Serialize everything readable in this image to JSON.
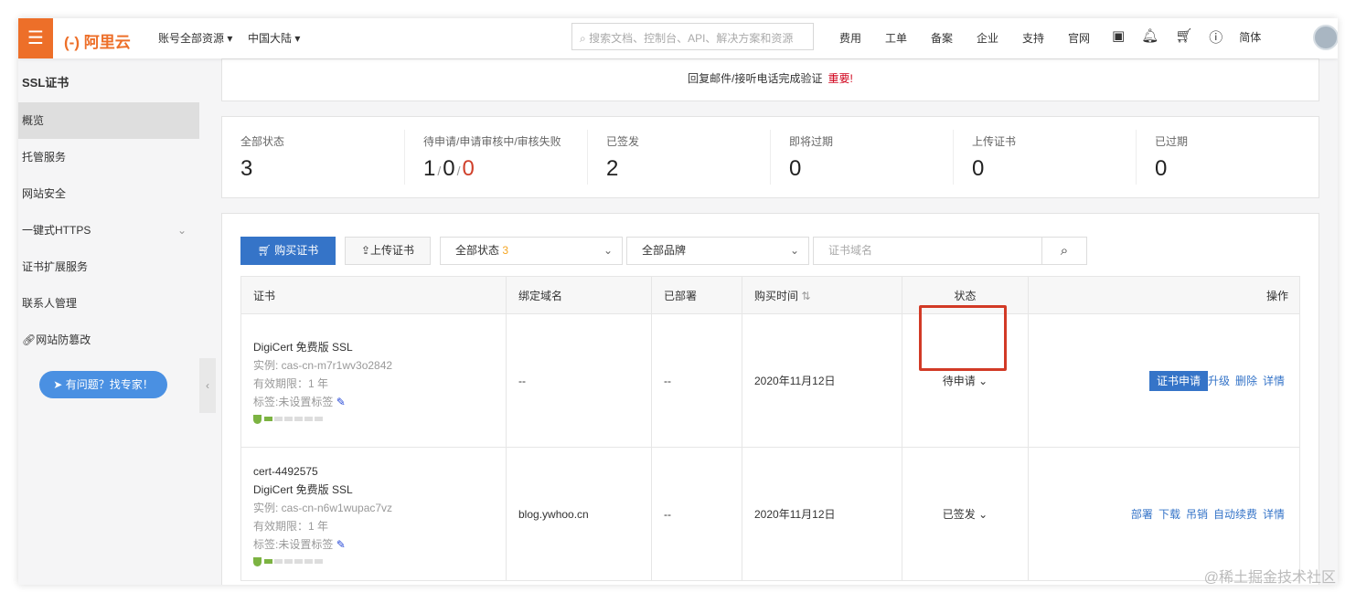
{
  "topbar": {
    "logo": "(-) 阿里云",
    "account": "账号全部资源 ▾",
    "region": "中国大陆 ▾",
    "search_placeholder": "搜索文档、控制台、API、解决方案和资源",
    "links": [
      "费用",
      "工单",
      "备案",
      "企业",
      "支持",
      "官网"
    ],
    "lang": "简体"
  },
  "sidebar": {
    "title": "SSL证书",
    "items": [
      "概览",
      "托管服务",
      "网站安全",
      "一键式HTTPS",
      "证书扩展服务",
      "联系人管理",
      "网站防篡改"
    ],
    "help": "有问题？找专家！"
  },
  "notice": {
    "text": "回复邮件/接听电话完成验证",
    "important": "重要!"
  },
  "stats": [
    {
      "label": "全部状态",
      "value": "3"
    },
    {
      "label": "待申请/申请审核中/审核失败",
      "values": [
        "1",
        "0",
        "0"
      ]
    },
    {
      "label": "已签发",
      "value": "2"
    },
    {
      "label": "即将过期",
      "value": "0"
    },
    {
      "label": "上传证书",
      "value": "0"
    },
    {
      "label": "已过期",
      "value": "0"
    }
  ],
  "toolbar": {
    "buy": "购买证书",
    "upload": "上传证书",
    "status_filter": "全部状态",
    "status_count": "3",
    "brand_filter": "全部品牌",
    "domain_placeholder": "证书域名"
  },
  "table": {
    "headers": [
      "证书",
      "绑定域名",
      "已部署",
      "购买时间",
      "状态",
      "操作"
    ],
    "rows": [
      {
        "name": "",
        "product": "DigiCert 免费版 SSL",
        "instance": "实例: cas-cn-m7r1wv3o2842",
        "validity": "有效期限：1 年",
        "tag": "标签:未设置标签",
        "domain": "--",
        "deployed": "--",
        "time": "2020年11月12日",
        "status": "待申请",
        "actions": [
          "证书申请",
          "升级",
          "删除",
          "详情"
        ],
        "progress": 1
      },
      {
        "name": "cert-4492575",
        "product": "DigiCert 免费版 SSL",
        "instance": "实例: cas-cn-n6w1wupac7vz",
        "validity": "有效期限：1 年",
        "tag": "标签:未设置标签",
        "domain": "blog.ywhoo.cn",
        "deployed": "--",
        "time": "2020年11月12日",
        "status": "已签发",
        "actions": [
          "部署",
          "下载",
          "吊销",
          "自动续费",
          "详情"
        ],
        "progress": 1
      }
    ]
  },
  "watermark": "@稀土掘金技术社区"
}
